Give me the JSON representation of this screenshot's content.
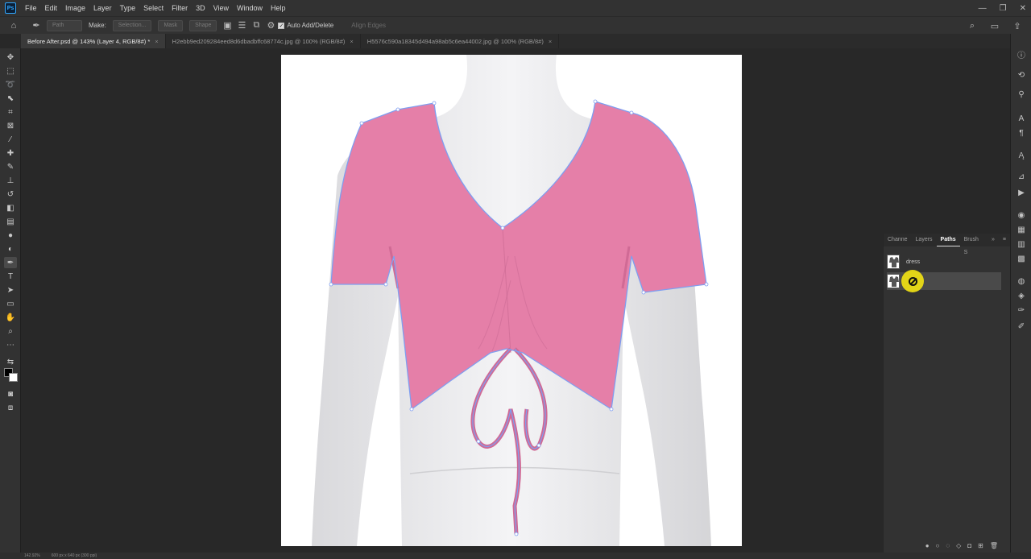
{
  "app": {
    "logo_text": "Ps",
    "menu": [
      "File",
      "Edit",
      "Image",
      "Layer",
      "Type",
      "Select",
      "Filter",
      "3D",
      "View",
      "Window",
      "Help"
    ],
    "window_controls": [
      "—",
      "❐",
      "✕"
    ]
  },
  "options_bar": {
    "mode_value": "Path",
    "make_label": "Make:",
    "selection_label": "Selection...",
    "mask_label": "Mask",
    "shape_label": "Shape",
    "auto_add_delete": "Auto Add/Delete",
    "auto_add_delete_checked": true,
    "align_edges": "Align Edges"
  },
  "document_tabs": [
    {
      "label": "Before After.psd @ 143% (Layer 4, RGB/8#) *",
      "active": true
    },
    {
      "label": "H2ebb9ed209284eed8d6dbadbffc68774c.jpg @ 100% (RGB/8#)",
      "active": false
    },
    {
      "label": "H5576c590a18345d494a98ab5c6ea44002.jpg @ 100% (RGB/8#)",
      "active": false
    }
  ],
  "tab_close": "×",
  "paths_panel": {
    "tabs": [
      "Channe",
      "Layers",
      "Paths",
      "Brush S"
    ],
    "active_tab": "Paths",
    "menu_glyph": "»",
    "rows": [
      {
        "name": "dress",
        "selected": false
      },
      {
        "name": "",
        "selected": true
      }
    ]
  },
  "status_bar": {
    "zoom": "142.92%",
    "doc_info": "600 px x 640 px (300 ppi)"
  },
  "colors": {
    "shirt_pink": "#e57fa8",
    "path_blue": "#7f9ef0",
    "cursor_yellow": "#f0e114"
  }
}
